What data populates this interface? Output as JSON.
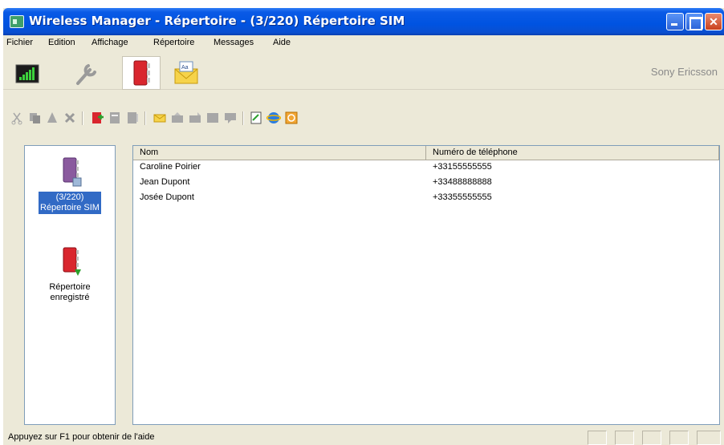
{
  "window": {
    "title": "Wireless Manager - Répertoire - (3/220) Répertoire SIM"
  },
  "menu": [
    "Fichier",
    "Edition",
    "Affichage",
    "Répertoire",
    "Messages",
    "Aide"
  ],
  "brand": "Sony Ericsson",
  "toolbar_icons": [
    "signal-icon",
    "wrench-icon",
    "phonebook-icon",
    "message-envelope-icon"
  ],
  "left_pane": {
    "items": [
      {
        "label_line1": "(3/220)",
        "label_line2": "Répertoire SIM",
        "selected": true
      },
      {
        "label_line1": "Répertoire",
        "label_line2": "enregistré",
        "selected": false
      }
    ]
  },
  "list": {
    "columns": [
      "Nom",
      "Numéro de téléphone"
    ],
    "rows": [
      {
        "name": "Caroline Poirier",
        "phone": "+33155555555"
      },
      {
        "name": "Jean Dupont",
        "phone": "+33488888888"
      },
      {
        "name": "Josée Dupont",
        "phone": "+33355555555"
      }
    ]
  },
  "status": "Appuyez sur F1 pour obtenir de l'aide",
  "colors": {
    "titlebar": "#0053e1",
    "selection": "#316ac5",
    "chrome": "#ece9d8"
  }
}
